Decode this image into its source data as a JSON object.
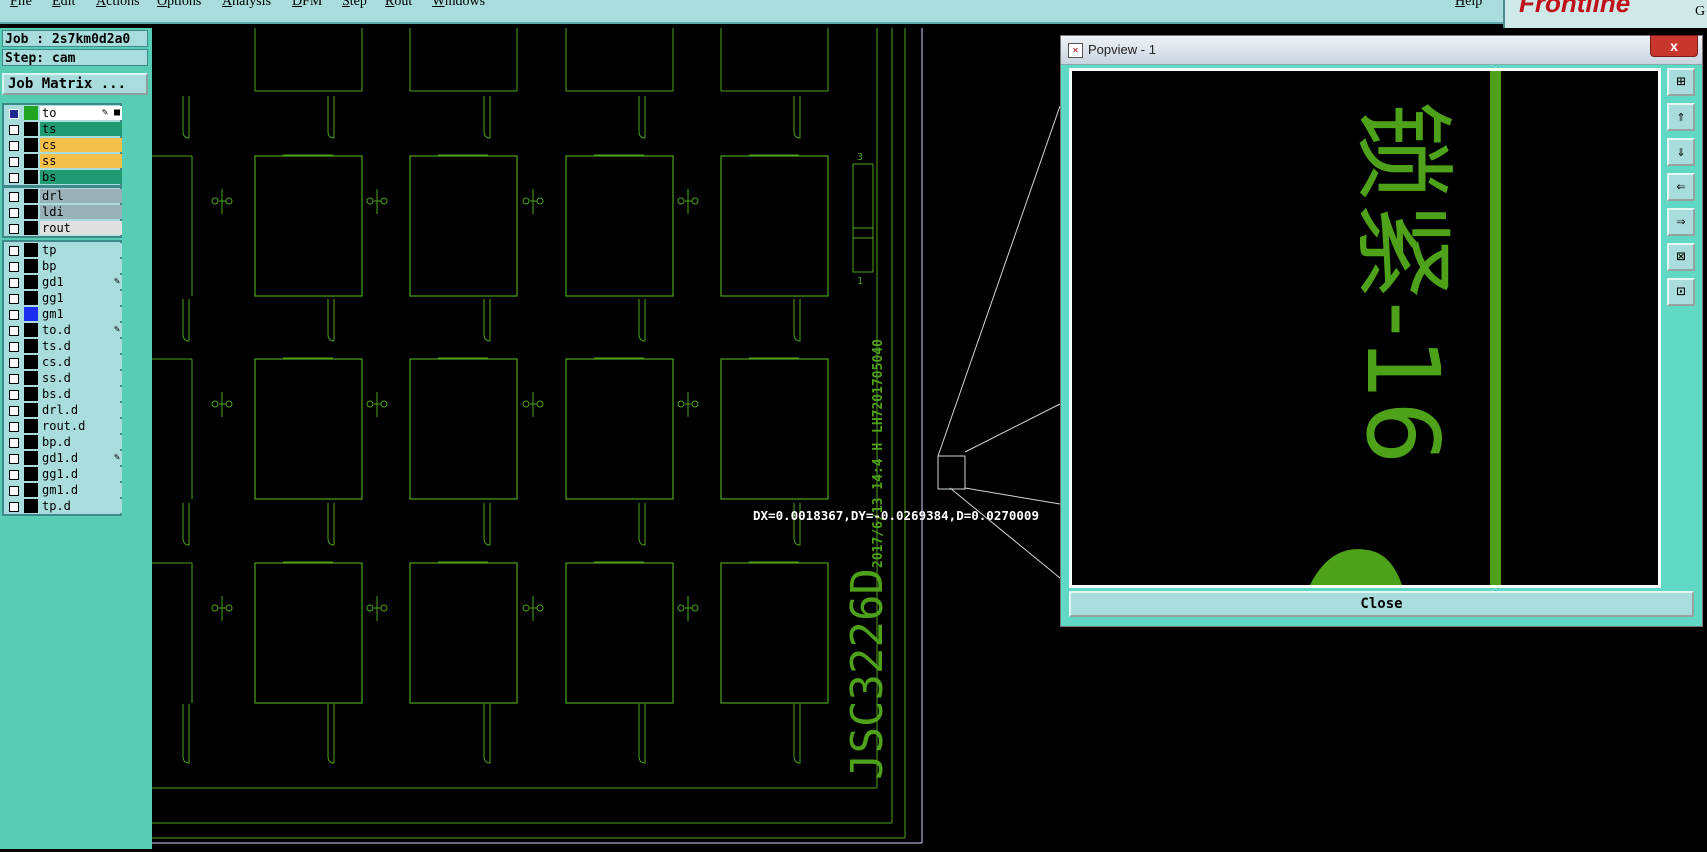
{
  "menu": [
    "File",
    "Edit",
    "Actions",
    "Options",
    "Analysis",
    "DFM",
    "Step",
    "Rout",
    "Windows",
    "Help"
  ],
  "logo": {
    "text": "Frontline",
    "right_fragment": "G"
  },
  "job": {
    "label": "Job : 2s7km0d2a0",
    "step": "Step: cam",
    "matrix_button": "Job Matrix ..."
  },
  "layers_board": [
    {
      "name": "to",
      "color": "#ffffff",
      "swatch": "#21a521",
      "selected": true,
      "flag": "✎ ■"
    },
    {
      "name": "ts",
      "color": "#1f9a73",
      "swatch": "#000000"
    },
    {
      "name": "cs",
      "color": "#f5c04a",
      "swatch": "#000000"
    },
    {
      "name": "ss",
      "color": "#f5c04a",
      "swatch": "#000000"
    },
    {
      "name": "bs",
      "color": "#1f9a73",
      "swatch": "#000000"
    }
  ],
  "layers_drill": [
    {
      "name": "drl",
      "color": "#9ab0b8",
      "swatch": "#000000"
    },
    {
      "name": "ldi",
      "color": "#9ab0b8",
      "swatch": "#000000"
    },
    {
      "name": "rout",
      "color": "#e0e0e0",
      "swatch": "#000000"
    }
  ],
  "layers_misc": [
    {
      "name": "tp",
      "color": "#a9dcdc",
      "swatch": "#000000"
    },
    {
      "name": "bp",
      "color": "#a9dcdc",
      "swatch": "#000000"
    },
    {
      "name": "gd1",
      "color": "#a9dcdc",
      "swatch": "#000000",
      "flag": "✎"
    },
    {
      "name": "gg1",
      "color": "#a9dcdc",
      "swatch": "#000000"
    },
    {
      "name": "gm1",
      "color": "#a9dcdc",
      "swatch": "#1e2ef0"
    },
    {
      "name": "to.d",
      "color": "#a9dcdc",
      "swatch": "#000000",
      "flag": "✎"
    },
    {
      "name": "ts.d",
      "color": "#a9dcdc",
      "swatch": "#000000"
    },
    {
      "name": "cs.d",
      "color": "#a9dcdc",
      "swatch": "#000000"
    },
    {
      "name": "ss.d",
      "color": "#a9dcdc",
      "swatch": "#000000"
    },
    {
      "name": "bs.d",
      "color": "#a9dcdc",
      "swatch": "#000000"
    },
    {
      "name": "drl.d",
      "color": "#a9dcdc",
      "swatch": "#000000"
    },
    {
      "name": "rout.d",
      "color": "#a9dcdc",
      "swatch": "#000000"
    },
    {
      "name": "bp.d",
      "color": "#a9dcdc",
      "swatch": "#000000"
    },
    {
      "name": "gd1.d",
      "color": "#a9dcdc",
      "swatch": "#000000",
      "flag": "✎"
    },
    {
      "name": "gg1.d",
      "color": "#a9dcdc",
      "swatch": "#000000"
    },
    {
      "name": "gm1.d",
      "color": "#a9dcdc",
      "swatch": "#000000"
    },
    {
      "name": "tp.d",
      "color": "#a9dcdc",
      "swatch": "#000000"
    }
  ],
  "canvas": {
    "measurement": "DX=0.0018367,DY=-0.0269384,D=0.0270009",
    "board_text_large": "JSC3226D",
    "board_text_date": "2017/6/13 14:4 H",
    "board_text_code": "LH7201705040",
    "part_marker_top": "3",
    "part_marker_bottom": "1"
  },
  "popup": {
    "title": "Popview - 1",
    "close_x": "x",
    "close_button": "Close",
    "zoom_text": "锁紧-16",
    "tools": [
      "zoom-fit-icon",
      "pan-up-icon",
      "pan-down-icon",
      "pan-left-icon",
      "pan-right-icon",
      "zoom-in-icon",
      "zoom-out-icon"
    ]
  },
  "colors": {
    "trace": "#4ea21a",
    "panel_bg": "#a9dcdc",
    "accent": "#56cdb4"
  }
}
